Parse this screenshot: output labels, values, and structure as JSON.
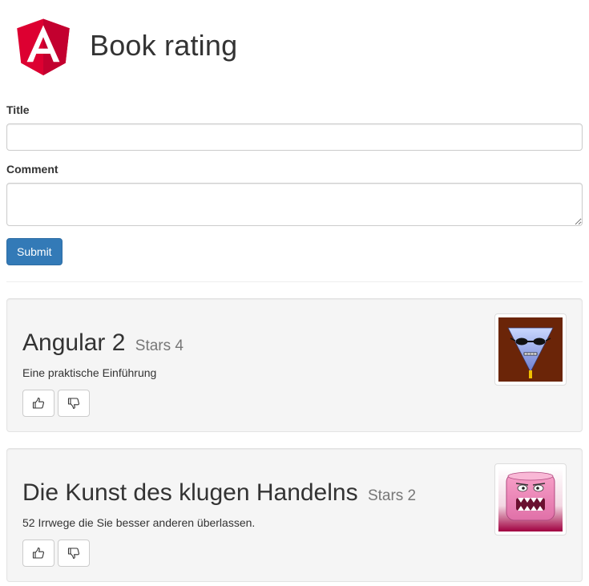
{
  "header": {
    "logo_icon": "angular-logo-icon",
    "title": "Book rating",
    "logo_colors": {
      "left": "#dd0031",
      "right": "#c3002f"
    }
  },
  "form": {
    "title_label": "Title",
    "title_value": "",
    "comment_label": "Comment",
    "comment_value": "",
    "submit_label": "Submit"
  },
  "theme": {
    "accent": "#337ab7",
    "card_bg": "#f5f5f5",
    "muted": "#777777"
  },
  "books": [
    {
      "title": "Angular 2",
      "stars_text": "Stars 4",
      "description": "Eine praktische Einführung",
      "thumbnail_icon": "sunglasses-triangle-face-icon",
      "like_icon": "thumbs-up-icon",
      "dislike_icon": "thumbs-down-icon"
    },
    {
      "title": "Die Kunst des klugen Handelns",
      "stars_text": "Stars 2",
      "description": "52 Irrwege die Sie besser anderen überlassen.",
      "thumbnail_icon": "pink-grimace-face-icon",
      "like_icon": "thumbs-up-icon",
      "dislike_icon": "thumbs-down-icon"
    }
  ]
}
